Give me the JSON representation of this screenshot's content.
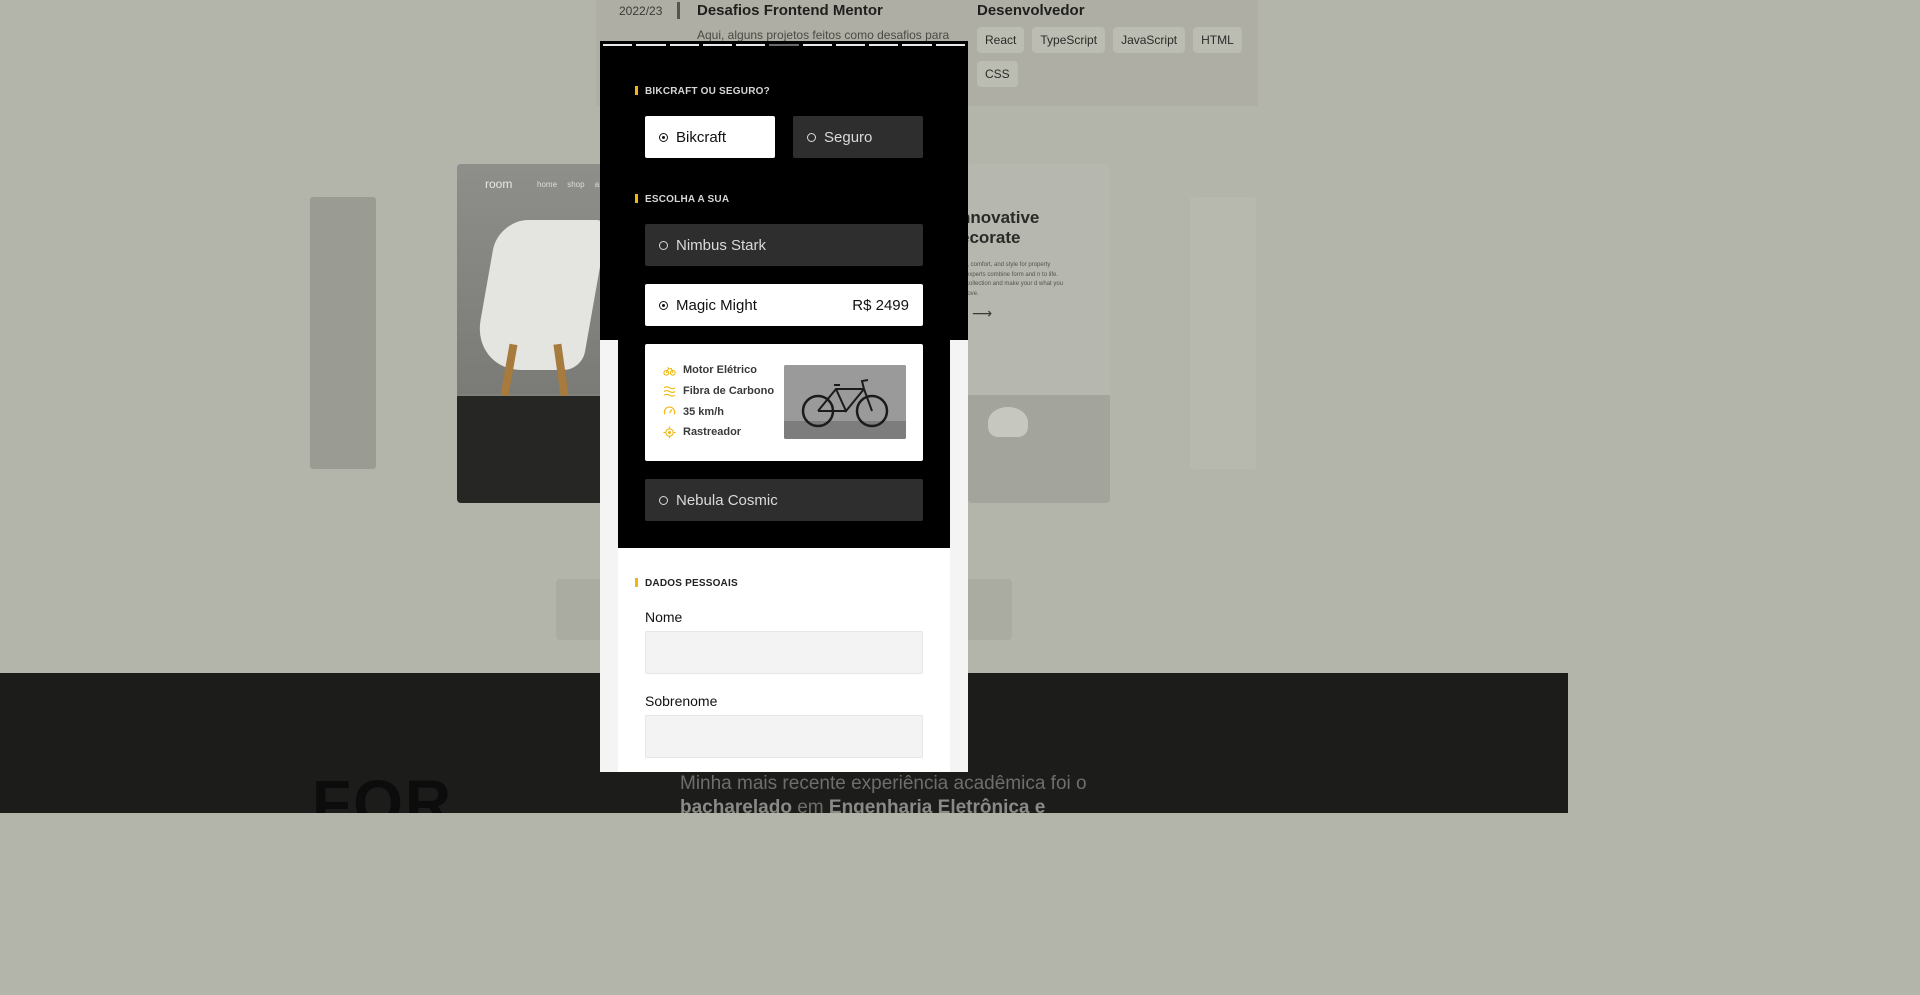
{
  "background": {
    "timeline_year": "2022/23",
    "timeline_title": "Desafios Frontend Mentor",
    "timeline_desc": "Aqui, alguns projetos feitos como desafios para",
    "role_title": "Desenvolvedor",
    "tags": [
      "React",
      "TypeScript",
      "JavaScript",
      "HTML",
      "CSS"
    ],
    "card1_logo": "room",
    "card1_nav": "home shop a",
    "card2_heading": "nnovative\necorate",
    "card2_body": "l, comfort, and style for property experts combine form and n to life. collection and make your d what you love.",
    "footer_big": "FOR",
    "footer_text_1": "Minha mais recente experiência acadêmica foi o",
    "footer_text_bold1": "bacharelado",
    "footer_text_2": " em ",
    "footer_text_bold2": "Engenharia Eletrônica e"
  },
  "modal": {
    "progress_steps": 11,
    "progress_dim_index": 5,
    "accent_color": "#f2b70f",
    "section1": {
      "title": "BIKCRAFT OU SEGURO?",
      "options": [
        {
          "label": "Bikcraft",
          "selected": true
        },
        {
          "label": "Seguro",
          "selected": false
        }
      ]
    },
    "section2": {
      "title": "ESCOLHA A SUA",
      "options": [
        {
          "label": "Nimbus Stark",
          "selected": false
        },
        {
          "label": "Magic Might",
          "selected": true,
          "price": "R$ 2499"
        },
        {
          "label": "Nebula Cosmic",
          "selected": false
        }
      ],
      "features": [
        {
          "icon": "electric-motor-icon",
          "label": "Motor Elétrico"
        },
        {
          "icon": "carbon-fiber-icon",
          "label": "Fibra de Carbono"
        },
        {
          "icon": "speedometer-icon",
          "label": "35 km/h"
        },
        {
          "icon": "gps-tracker-icon",
          "label": "Rastreador"
        }
      ]
    },
    "section3": {
      "title": "DADOS PESSOAIS",
      "fields": [
        {
          "label": "Nome",
          "value": "",
          "placeholder": ""
        },
        {
          "label": "Sobrenome",
          "value": "",
          "placeholder": ""
        }
      ]
    }
  }
}
